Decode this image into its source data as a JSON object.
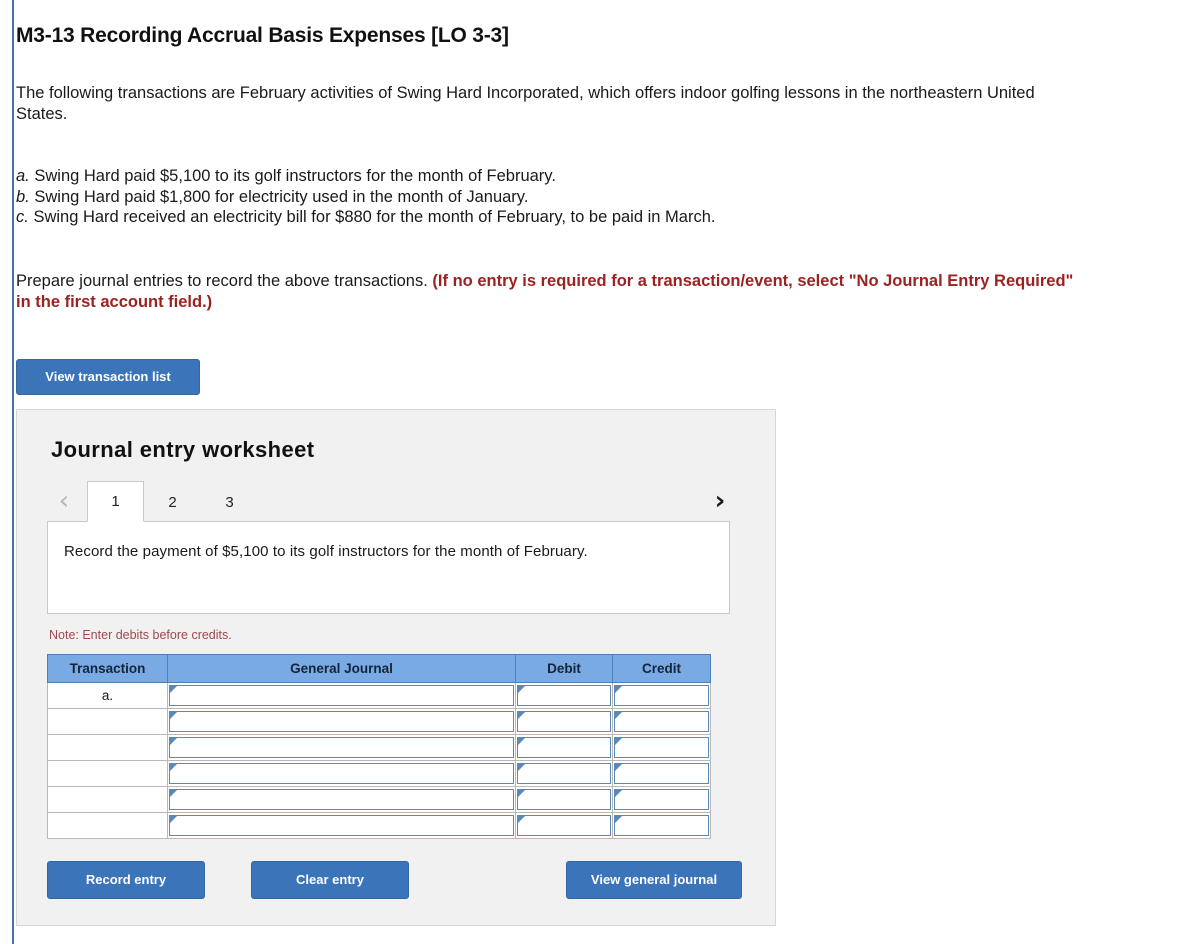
{
  "problem": {
    "title": "M3-13 Recording Accrual Basis Expenses [LO 3-3]",
    "intro": "The following transactions are February activities of Swing Hard Incorporated, which offers indoor golfing lessons in the northeastern United States.",
    "transactions": [
      {
        "label": "a.",
        "text": "Swing Hard paid $5,100 to its golf instructors for the month of February."
      },
      {
        "label": "b.",
        "text": "Swing Hard paid $1,800 for electricity used in the month of January."
      },
      {
        "label": "c.",
        "text": "Swing Hard received an electricity bill for $880 for the month of February, to be paid in March."
      }
    ],
    "prepare_plain": "Prepare journal entries to record the above transactions.",
    "prepare_emph": "(If no entry is required for a transaction/event, select \"No Journal Entry Required\" in the first account field.)"
  },
  "buttons": {
    "view_transaction_list": "View transaction list",
    "record_entry": "Record entry",
    "clear_entry": "Clear entry",
    "view_general_journal": "View general journal"
  },
  "worksheet": {
    "title": "Journal entry worksheet",
    "prev_arrow": "‹",
    "next_arrow": "›",
    "tabs": [
      {
        "label": "1",
        "active": true
      },
      {
        "label": "2",
        "active": false
      },
      {
        "label": "3",
        "active": false
      }
    ],
    "prompt": "Record the payment of $5,100 to its golf instructors for the month of February.",
    "note": "Note: Enter debits before credits.",
    "table": {
      "headers": [
        "Transaction",
        "General Journal",
        "Debit",
        "Credit"
      ],
      "rows": [
        {
          "transaction": "a.",
          "general_journal": "",
          "debit": "",
          "credit": ""
        },
        {
          "transaction": "",
          "general_journal": "",
          "debit": "",
          "credit": ""
        },
        {
          "transaction": "",
          "general_journal": "",
          "debit": "",
          "credit": ""
        },
        {
          "transaction": "",
          "general_journal": "",
          "debit": "",
          "credit": ""
        },
        {
          "transaction": "",
          "general_journal": "",
          "debit": "",
          "credit": ""
        },
        {
          "transaction": "",
          "general_journal": "",
          "debit": "",
          "credit": ""
        }
      ]
    }
  },
  "colors": {
    "button_blue": "#3b74b9",
    "table_header_blue": "#7aaae4",
    "emphasis_red": "#9c2222",
    "note_red": "#9c4a4a",
    "panel_background": "#f1f1f1",
    "rule_blue": "#4a6fa5"
  }
}
